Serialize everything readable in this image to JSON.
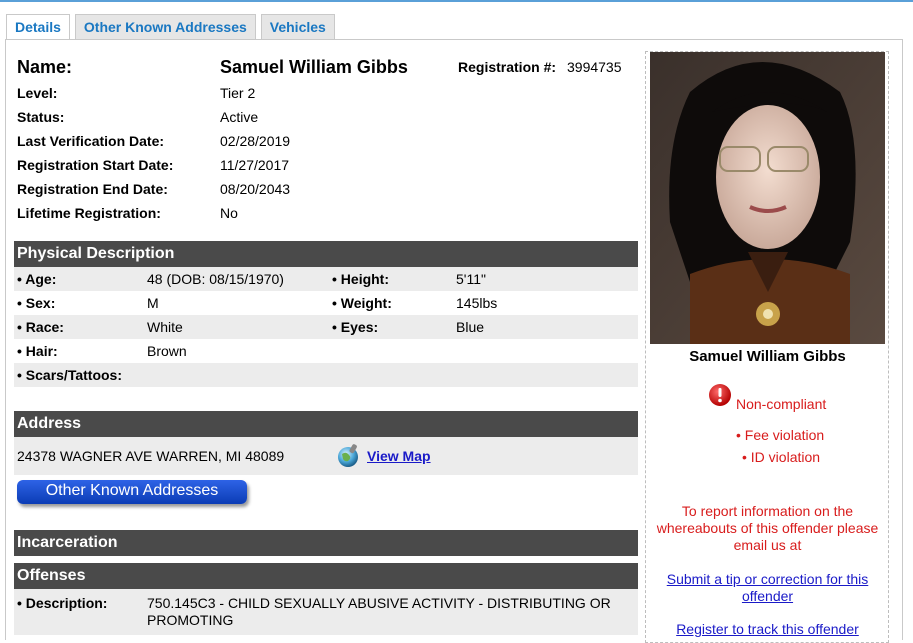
{
  "tabs": [
    {
      "label": "Details"
    },
    {
      "label": "Other Known Addresses"
    },
    {
      "label": "Vehicles"
    }
  ],
  "header": {
    "name_label": "Name:",
    "name_value": "Samuel William Gibbs",
    "reg_label": "Registration #:",
    "reg_value": "3994735"
  },
  "info": [
    {
      "label": "Level:",
      "value": "Tier 2"
    },
    {
      "label": "Status:",
      "value": "Active"
    },
    {
      "label": "Last Verification Date:",
      "value": "02/28/2019"
    },
    {
      "label": "Registration Start Date:",
      "value": "11/27/2017"
    },
    {
      "label": "Registration End Date:",
      "value": "08/20/2043"
    },
    {
      "label": "Lifetime Registration:",
      "value": "No"
    }
  ],
  "physical": {
    "title": "Physical Description",
    "age_label": "• Age:",
    "age_value": "48  (DOB: 08/15/1970)",
    "height_label": "• Height:",
    "height_value": "5'11\"",
    "sex_label": "• Sex:",
    "sex_value": "M",
    "weight_label": "• Weight:",
    "weight_value": "145lbs",
    "race_label": "• Race:",
    "race_value": "White",
    "eyes_label": "• Eyes:",
    "eyes_value": "Blue",
    "hair_label": "• Hair:",
    "hair_value": "Brown",
    "scars_label": "• Scars/Tattoos:",
    "scars_value": ""
  },
  "address": {
    "title": "Address",
    "value": "24378 WAGNER AVE WARREN, MI 48089",
    "map_link": "View Map",
    "button": "Other Known Addresses"
  },
  "incarceration": {
    "title": "Incarceration"
  },
  "offenses": {
    "title": "Offenses",
    "desc_label": "• Description:",
    "desc_line1": "750.145C3 - CHILD SEXUALLY ABUSIVE ACTIVITY - DISTRIBUTING OR",
    "desc_line2": "PROMOTING"
  },
  "sidebar": {
    "name": "Samuel William Gibbs",
    "compliance": "Non-compliant",
    "violations": [
      "Fee violation",
      "ID violation"
    ],
    "report_text_1": "To report information on the",
    "report_text_2": "whereabouts of this offender please",
    "report_text_3": "email us at",
    "tip_link_1": "Submit a tip or correction for this",
    "tip_link_2": "offender",
    "register_link": "Register to track this offender"
  },
  "colors": {
    "accent": "#1a78c2",
    "section_header": "#4a4a4a",
    "alert_red": "#d81c1c",
    "link": "#1a1ac8"
  },
  "icons": {
    "map": "globe-icon",
    "alert": "exclamation-circle-icon"
  }
}
